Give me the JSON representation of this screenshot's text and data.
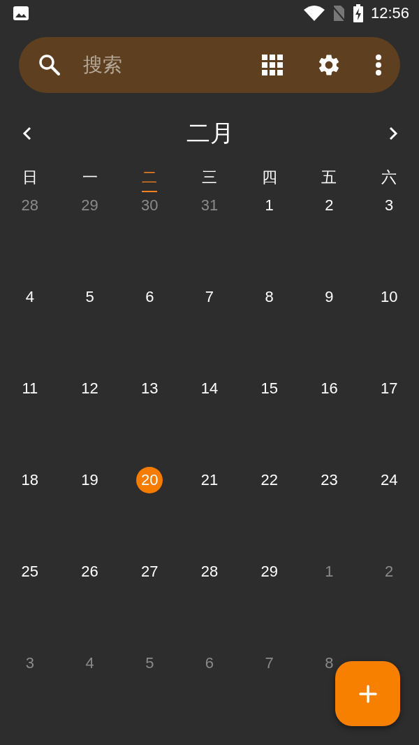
{
  "status_bar": {
    "time": "12:56"
  },
  "search": {
    "placeholder": "搜索"
  },
  "month": {
    "title": "二月"
  },
  "weekdays": [
    {
      "label": "日",
      "current": false
    },
    {
      "label": "一",
      "current": false
    },
    {
      "label": "二",
      "current": true
    },
    {
      "label": "三",
      "current": false
    },
    {
      "label": "四",
      "current": false
    },
    {
      "label": "五",
      "current": false
    },
    {
      "label": "六",
      "current": false
    }
  ],
  "weeks": [
    [
      {
        "day": "28",
        "muted": true,
        "selected": false
      },
      {
        "day": "29",
        "muted": true,
        "selected": false
      },
      {
        "day": "30",
        "muted": true,
        "selected": false
      },
      {
        "day": "31",
        "muted": true,
        "selected": false
      },
      {
        "day": "1",
        "muted": false,
        "selected": false
      },
      {
        "day": "2",
        "muted": false,
        "selected": false
      },
      {
        "day": "3",
        "muted": false,
        "selected": false
      }
    ],
    [
      {
        "day": "4",
        "muted": false,
        "selected": false
      },
      {
        "day": "5",
        "muted": false,
        "selected": false
      },
      {
        "day": "6",
        "muted": false,
        "selected": false
      },
      {
        "day": "7",
        "muted": false,
        "selected": false
      },
      {
        "day": "8",
        "muted": false,
        "selected": false
      },
      {
        "day": "9",
        "muted": false,
        "selected": false
      },
      {
        "day": "10",
        "muted": false,
        "selected": false
      }
    ],
    [
      {
        "day": "11",
        "muted": false,
        "selected": false
      },
      {
        "day": "12",
        "muted": false,
        "selected": false
      },
      {
        "day": "13",
        "muted": false,
        "selected": false
      },
      {
        "day": "14",
        "muted": false,
        "selected": false
      },
      {
        "day": "15",
        "muted": false,
        "selected": false
      },
      {
        "day": "16",
        "muted": false,
        "selected": false
      },
      {
        "day": "17",
        "muted": false,
        "selected": false
      }
    ],
    [
      {
        "day": "18",
        "muted": false,
        "selected": false
      },
      {
        "day": "19",
        "muted": false,
        "selected": false
      },
      {
        "day": "20",
        "muted": false,
        "selected": true
      },
      {
        "day": "21",
        "muted": false,
        "selected": false
      },
      {
        "day": "22",
        "muted": false,
        "selected": false
      },
      {
        "day": "23",
        "muted": false,
        "selected": false
      },
      {
        "day": "24",
        "muted": false,
        "selected": false
      }
    ],
    [
      {
        "day": "25",
        "muted": false,
        "selected": false
      },
      {
        "day": "26",
        "muted": false,
        "selected": false
      },
      {
        "day": "27",
        "muted": false,
        "selected": false
      },
      {
        "day": "28",
        "muted": false,
        "selected": false
      },
      {
        "day": "29",
        "muted": false,
        "selected": false
      },
      {
        "day": "1",
        "muted": true,
        "selected": false
      },
      {
        "day": "2",
        "muted": true,
        "selected": false
      }
    ],
    [
      {
        "day": "3",
        "muted": true,
        "selected": false
      },
      {
        "day": "4",
        "muted": true,
        "selected": false
      },
      {
        "day": "5",
        "muted": true,
        "selected": false
      },
      {
        "day": "6",
        "muted": true,
        "selected": false
      },
      {
        "day": "7",
        "muted": true,
        "selected": false
      },
      {
        "day": "8",
        "muted": true,
        "selected": false
      }
    ]
  ]
}
